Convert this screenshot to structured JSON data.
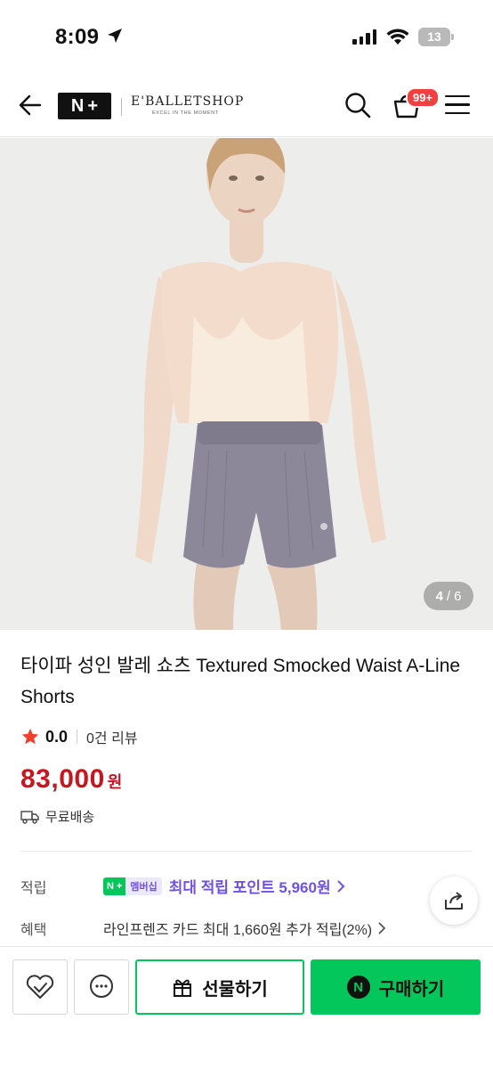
{
  "status_bar": {
    "time": "8:09",
    "battery": "13"
  },
  "header": {
    "logo_n": "N",
    "logo_plus": "+",
    "brand_name": "E'BALLETSHOP",
    "brand_tagline": "EXCEL IN THE MOMENT",
    "cart_badge": "99+"
  },
  "gallery": {
    "current": "4",
    "separator": "/",
    "total": "6"
  },
  "product": {
    "title": "타이파 성인 발레 쇼츠 Textured Smocked Waist A-Line Shorts",
    "rating": "0.0",
    "reviews": "0건 리뷰",
    "price": "83,000",
    "currency": "원",
    "shipping": "무료배송"
  },
  "benefits": {
    "points_label": "적립",
    "badge_n": "N",
    "badge_plus": "+",
    "badge_member": "멤버십",
    "points_text": "최대 적립 포인트 5,960원",
    "benefit_label": "혜택",
    "benefit_text": "라인프렌즈 카드 최대 1,660원 추가 적립(2%)"
  },
  "actions": {
    "gift": "선물하기",
    "buy": "구매하기",
    "buy_icon": "N"
  },
  "colors": {
    "naver_green": "#03c75a",
    "price_red": "#c6161f",
    "points_purple": "#6f51e6"
  }
}
